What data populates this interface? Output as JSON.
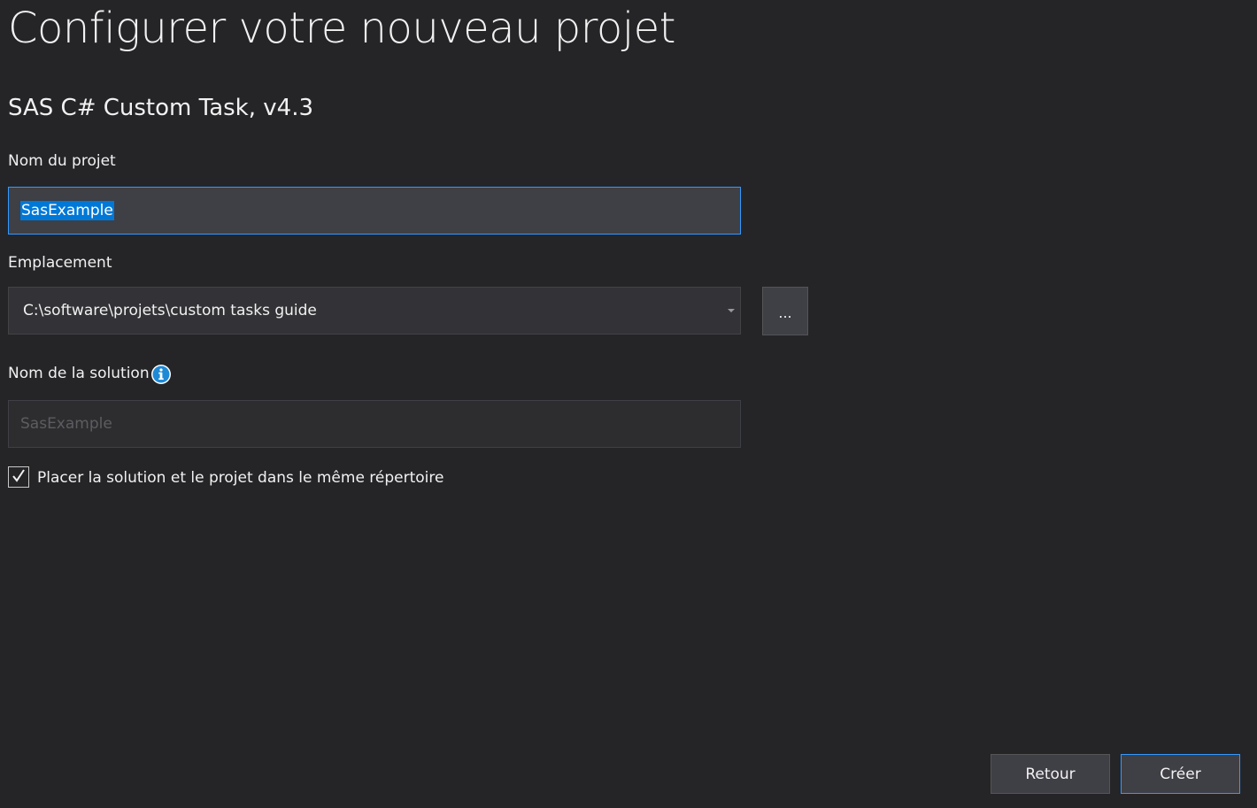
{
  "header": {
    "title": "Configurer votre nouveau projet",
    "template_name": "SAS C# Custom Task, v4.3"
  },
  "project_name": {
    "label": "Nom du projet",
    "value": "SasExample"
  },
  "location": {
    "label": "Emplacement",
    "value": "C:\\software\\projets\\custom tasks guide",
    "browse_label": "..."
  },
  "solution_name": {
    "label": "Nom de la solution",
    "placeholder": "SasExample",
    "info_icon": "info-icon"
  },
  "same_directory": {
    "label": "Placer la solution et le projet dans le même répertoire",
    "checked": true
  },
  "footer": {
    "back_label": "Retour",
    "create_label": "Créer"
  },
  "colors": {
    "background": "#252528",
    "accent": "#3399ff",
    "selection": "#0078d7"
  }
}
